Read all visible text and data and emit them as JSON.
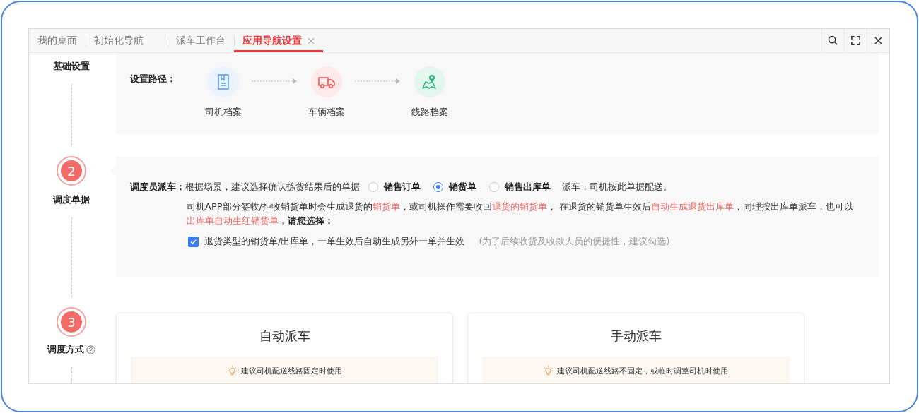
{
  "tabs": [
    {
      "label": "我的桌面",
      "selected": false,
      "closable": false
    },
    {
      "label": "初始化导航",
      "selected": false,
      "closable": false
    },
    {
      "label": "派车工作台",
      "selected": false,
      "closable": false
    },
    {
      "label": "应用导航设置",
      "selected": true,
      "closable": true
    }
  ],
  "basic_settings": {
    "step_title": "基础设置",
    "path_label": "设置路径：",
    "path": [
      {
        "label": "司机档案",
        "kind": "file"
      },
      {
        "label": "车辆档案",
        "kind": "truck"
      },
      {
        "label": "线路档案",
        "kind": "map"
      }
    ]
  },
  "dispatch_document": {
    "number": "2",
    "step_title": "调度单据",
    "label": "调度员派车：",
    "prompt": "根据场景，建议选择确认拣货结果后的单据",
    "options": [
      {
        "label": "销售订单",
        "selected": false
      },
      {
        "label": "销货单",
        "selected": true
      },
      {
        "label": "销售出库单",
        "selected": false
      }
    ],
    "suffix": "派车，司机按此单据配送。",
    "note": [
      {
        "text": "司机APP部分签收/拒收销货单时会生成退货的",
        "kind": "plain"
      },
      {
        "text": "销货单",
        "kind": "highlight"
      },
      {
        "text": "，或司机操作需要收回",
        "kind": "plain"
      },
      {
        "text": "退货的销货单",
        "kind": "highlight"
      },
      {
        "text": "， 在退货的销货单生效后",
        "kind": "plain"
      },
      {
        "text": "自动生成退货出库单",
        "kind": "highlight"
      },
      {
        "text": "，同理按出库单派车，也可以",
        "kind": "plain"
      },
      {
        "text": "出库单自动生红销货单",
        "kind": "highlight"
      },
      {
        "text": "，请您选择：",
        "kind": "bold"
      }
    ],
    "checkbox": {
      "label": "退货类型的销货单/出库单，一单生效后自动生成另外一单并生效",
      "checked": true,
      "hint": "(为了后续收货及收款人员的便捷性，建议勾选)"
    }
  },
  "dispatch_mode": {
    "number": "3",
    "step_title": "调度方式",
    "help": true,
    "cards": [
      {
        "title": "自动派车",
        "tip": "建议司机配送线路固定时使用"
      },
      {
        "title": "手动派车",
        "tip": "建议司机配送线路不固定，或临时调整司机时使用"
      }
    ]
  }
}
